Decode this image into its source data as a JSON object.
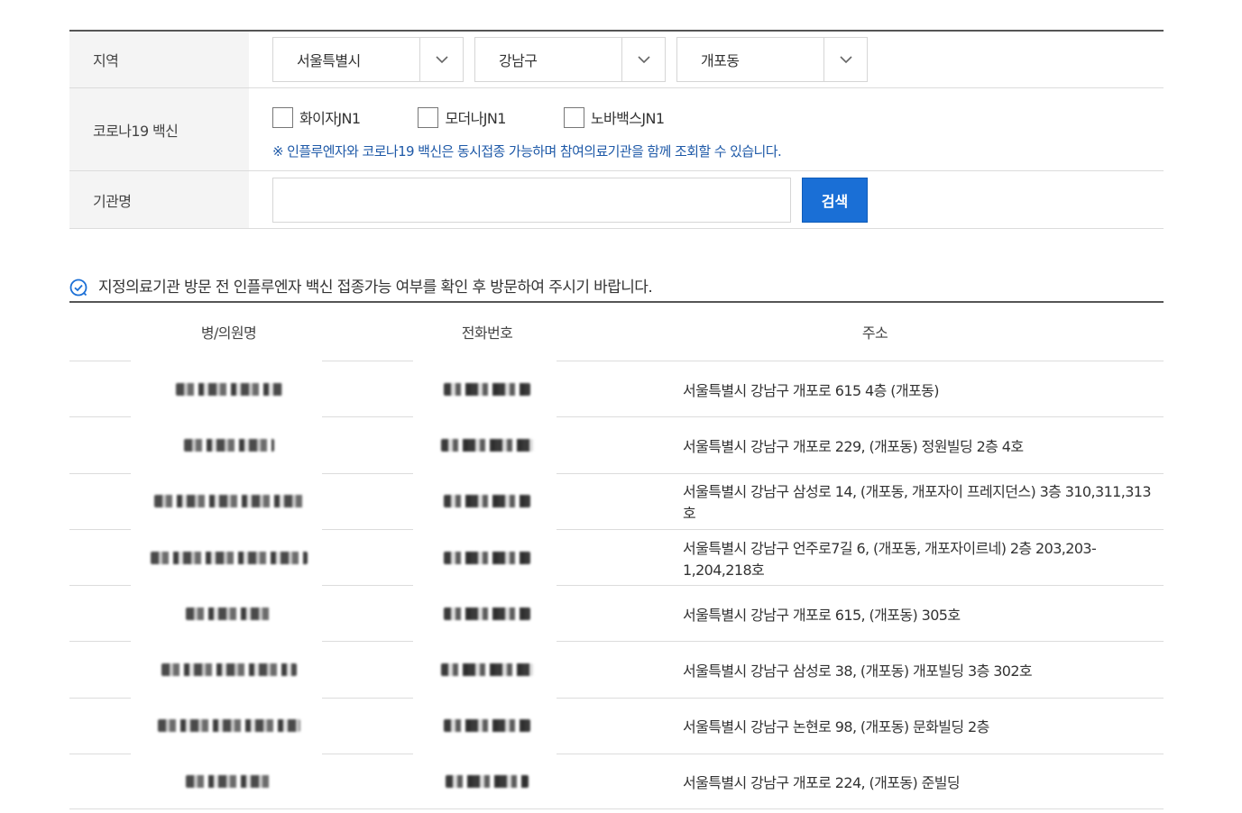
{
  "form": {
    "region": {
      "label": "지역",
      "selects": [
        {
          "value": "서울특별시"
        },
        {
          "value": "강남구"
        },
        {
          "value": "개포동"
        }
      ]
    },
    "vaccine": {
      "label": "코로나19 백신",
      "options": [
        {
          "label": "화이자JN1",
          "checked": false
        },
        {
          "label": "모더나JN1",
          "checked": false
        },
        {
          "label": "노바백스JN1",
          "checked": false
        }
      ],
      "notice": "※ 인플루엔자와 코로나19 백신은 동시접종 가능하며 참여의료기관을 함께 조회할 수 있습니다."
    },
    "institution": {
      "label": "기관명",
      "value": "",
      "placeholder": "",
      "search_button": "검색"
    }
  },
  "info_text": "지정의료기관 방문 전 인플루엔자 백신 접종가능 여부를 확인 후 방문하여 주시기 바랍니다.",
  "table": {
    "headers": [
      "병/의원명",
      "전화번호",
      "주소"
    ],
    "rows": [
      {
        "address": "서울특별시 강남구 개포로 615 4층 (개포동)"
      },
      {
        "address": "서울특별시 강남구 개포로 229, (개포동) 정원빌딩 2층 4호"
      },
      {
        "address": "서울특별시 강남구 삼성로 14, (개포동, 개포자이 프레지던스) 3층 310,311,313호"
      },
      {
        "address": "서울특별시 강남구 언주로7길 6, (개포동, 개포자이르네) 2층 203,203-1,204,218호"
      },
      {
        "address": "서울특별시 강남구 개포로 615, (개포동) 305호"
      },
      {
        "address": "서울특별시 강남구 삼성로 38, (개포동) 개포빌딩 3층 302호"
      },
      {
        "address": "서울특별시 강남구 논현로 98, (개포동) 문화빌딩 2층"
      },
      {
        "address": "서울특별시 강남구 개포로 224, (개포동) 준빌딩"
      }
    ]
  },
  "colors": {
    "accent": "#1a6fd6",
    "notice": "#1f5aa8",
    "label_bg": "#f4f4f4"
  }
}
